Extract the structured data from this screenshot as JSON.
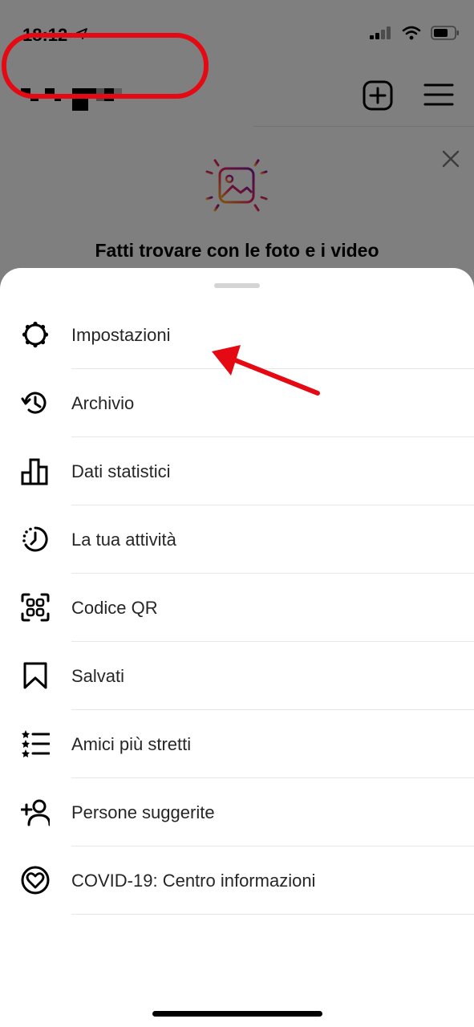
{
  "status_bar": {
    "time": "18:12",
    "icons": [
      "location-arrow-icon",
      "cellular-signal-icon",
      "wifi-icon",
      "battery-icon"
    ]
  },
  "header": {
    "username_obscured": true,
    "new_post_icon": "plus-square-icon",
    "menu_icon": "hamburger-menu-icon"
  },
  "prompt": {
    "title": "Fatti trovare con le foto e i video",
    "icon": "photo-sparkle-icon",
    "close_icon": "close-icon"
  },
  "menu": {
    "items": [
      {
        "label": "Impostazioni",
        "icon": "settings-gear-icon"
      },
      {
        "label": "Archivio",
        "icon": "archive-history-icon"
      },
      {
        "label": "Dati statistici",
        "icon": "bar-chart-icon"
      },
      {
        "label": "La tua attività",
        "icon": "activity-clock-icon"
      },
      {
        "label": "Codice QR",
        "icon": "qr-code-icon"
      },
      {
        "label": "Salvati",
        "icon": "bookmark-icon"
      },
      {
        "label": "Amici più stretti",
        "icon": "close-friends-list-icon"
      },
      {
        "label": "Persone suggerite",
        "icon": "add-person-icon"
      },
      {
        "label": "COVID-19: Centro informazioni",
        "icon": "covid-heart-icon"
      }
    ]
  },
  "annotation": {
    "highlight_color": "#e50914",
    "highlighted_item": "Impostazioni"
  },
  "colors": {
    "overlay": "rgba(0,0,0,0.5)",
    "text": "#262626"
  }
}
